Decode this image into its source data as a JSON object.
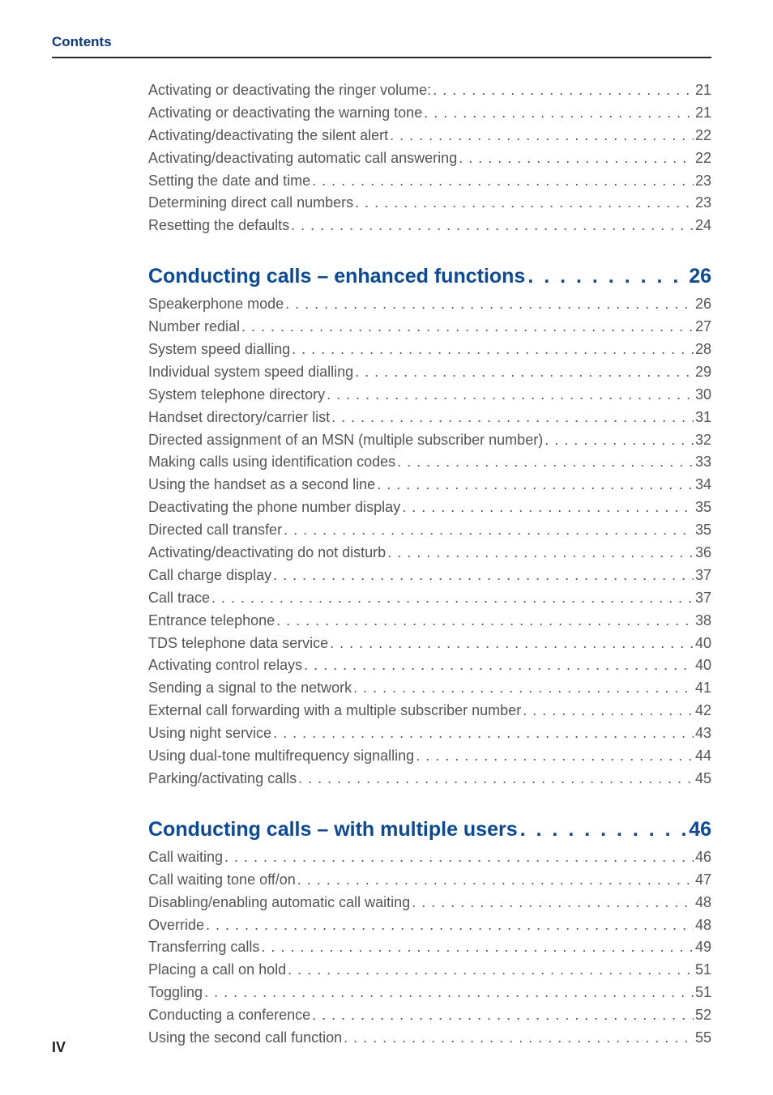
{
  "header": {
    "label": "Contents"
  },
  "footer": {
    "page_number": "IV"
  },
  "toc": [
    {
      "heading": null,
      "entries": [
        {
          "title": "Activating or deactivating the ringer volume: ",
          "page": "21"
        },
        {
          "title": "Activating or deactivating the warning tone",
          "page": "21"
        },
        {
          "title": "Activating/deactivating the silent alert",
          "page": "22"
        },
        {
          "title": "Activating/deactivating automatic call answering",
          "page": "22"
        },
        {
          "title": "Setting the date and time",
          "page": "23"
        },
        {
          "title": "Determining direct call numbers",
          "page": "23"
        },
        {
          "title": "Resetting the defaults",
          "page": "24"
        }
      ]
    },
    {
      "heading": {
        "title": "Conducting calls – enhanced functions ",
        "page": "26"
      },
      "entries": [
        {
          "title": "Speakerphone mode",
          "page": "26"
        },
        {
          "title": "Number redial ",
          "page": "27"
        },
        {
          "title": "System speed dialling",
          "page": "28"
        },
        {
          "title": "Individual system speed dialling ",
          "page": "29"
        },
        {
          "title": "System telephone directory ",
          "page": "30"
        },
        {
          "title": "Handset directory/carrier list ",
          "page": "31"
        },
        {
          "title": "Directed assignment of an MSN (multiple subscriber number) ",
          "page": "32"
        },
        {
          "title": "Making calls using identification codes",
          "page": "33"
        },
        {
          "title": "Using the handset as a second line",
          "page": "34"
        },
        {
          "title": "Deactivating the phone number display ",
          "page": "35"
        },
        {
          "title": "Directed call transfer ",
          "page": "35"
        },
        {
          "title": "Activating/deactivating do not disturb",
          "page": "36"
        },
        {
          "title": "Call charge display",
          "page": "37"
        },
        {
          "title": "Call trace ",
          "page": "37"
        },
        {
          "title": "Entrance telephone",
          "page": "38"
        },
        {
          "title": "TDS telephone data service",
          "page": "40"
        },
        {
          "title": "Activating control relays ",
          "page": "40"
        },
        {
          "title": "Sending a signal to the network ",
          "page": "41"
        },
        {
          "title": "External call forwarding with a multiple subscriber number",
          "page": "42"
        },
        {
          "title": "Using night service ",
          "page": "43"
        },
        {
          "title": "Using dual-tone multifrequency signalling",
          "page": "44"
        },
        {
          "title": "Parking/activating calls",
          "page": "45"
        }
      ]
    },
    {
      "heading": {
        "title": "Conducting calls – with multiple users",
        "page": "46"
      },
      "entries": [
        {
          "title": "Call waiting ",
          "page": "46"
        },
        {
          "title": "Call waiting tone off/on ",
          "page": "47"
        },
        {
          "title": "Disabling/enabling automatic call waiting ",
          "page": "48"
        },
        {
          "title": "Override",
          "page": "48"
        },
        {
          "title": "Transferring calls",
          "page": "49"
        },
        {
          "title": "Placing a call on hold",
          "page": "51"
        },
        {
          "title": "Toggling",
          "page": "51"
        },
        {
          "title": "Conducting a conference",
          "page": "52"
        },
        {
          "title": "Using the second call function ",
          "page": "55"
        }
      ]
    }
  ]
}
